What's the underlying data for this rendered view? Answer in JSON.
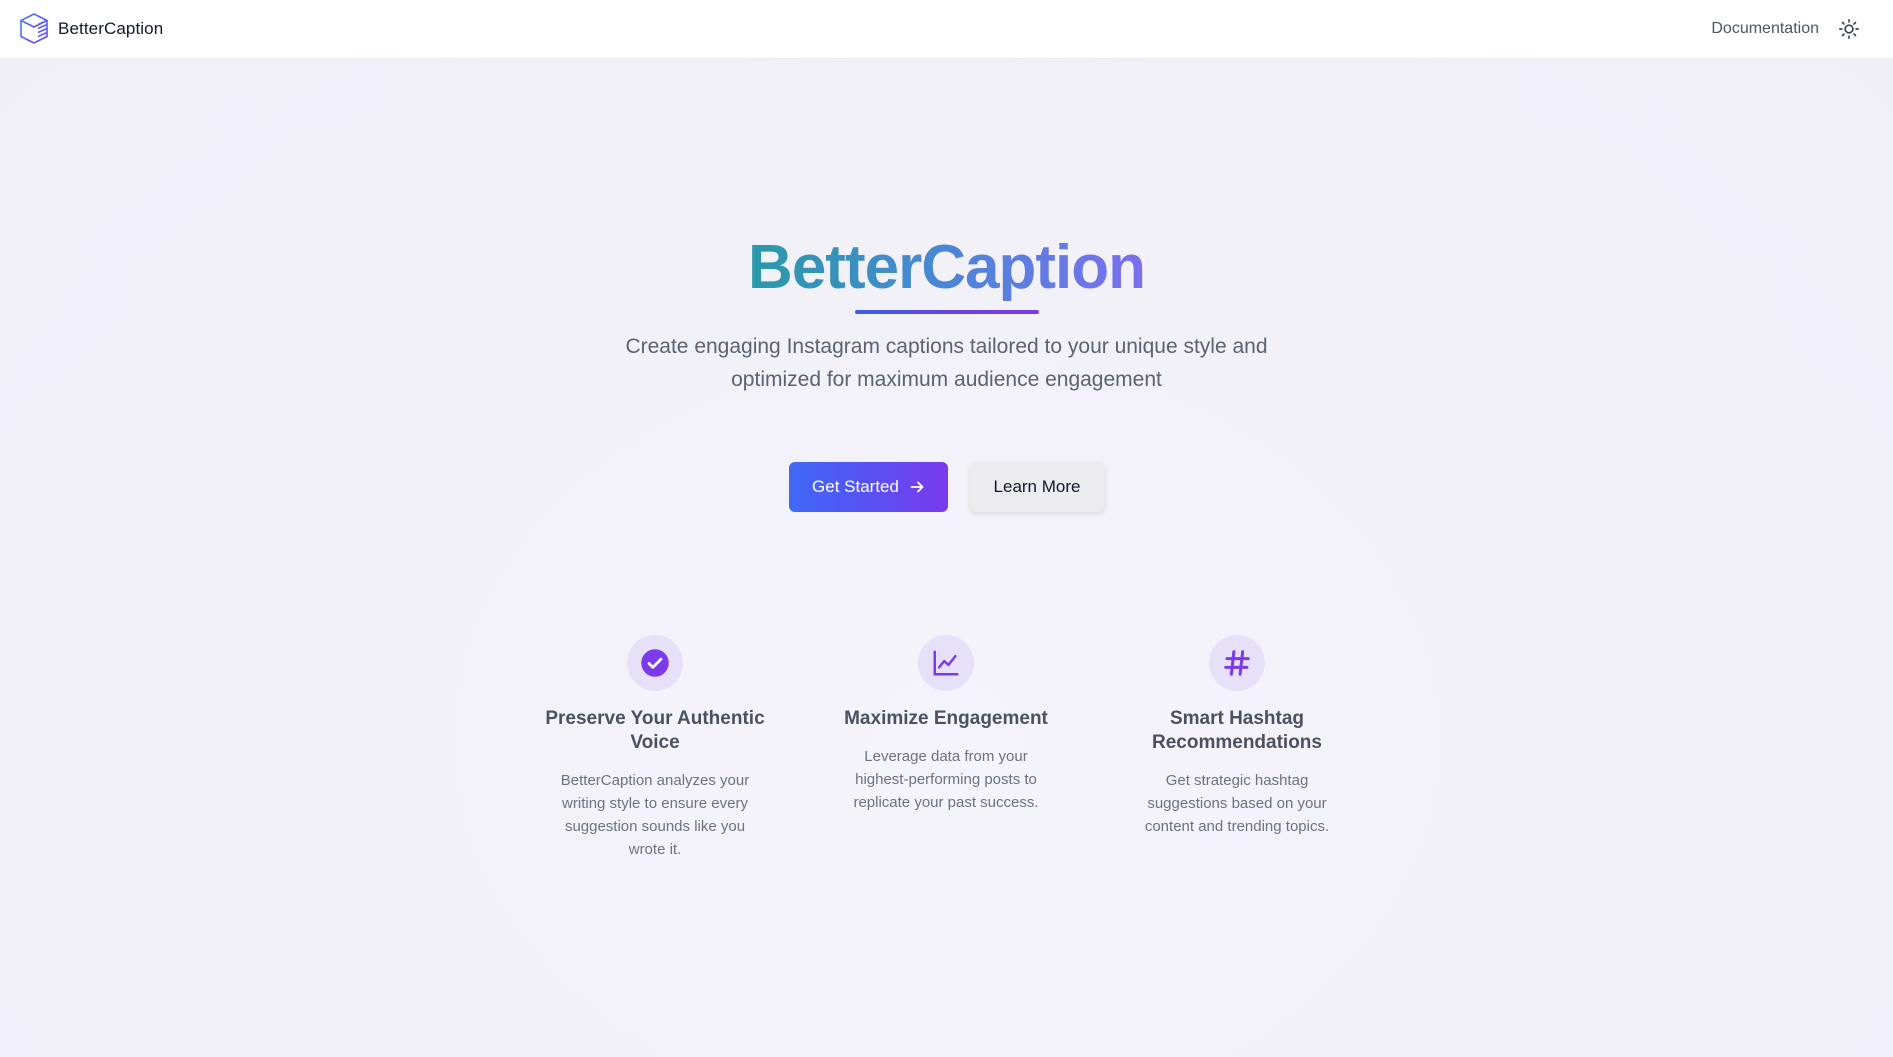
{
  "nav": {
    "brand": "BetterCaption",
    "documentation": "Documentation",
    "theme_icon": "sun-icon"
  },
  "hero": {
    "title": "BetterCaption",
    "subtitle": "Create engaging Instagram captions tailored to your unique style and optimized for maximum audience engagement",
    "primary_cta": "Get Started",
    "secondary_cta": "Learn More"
  },
  "features": [
    {
      "icon": "check-circle-icon",
      "title": "Preserve Your Authentic Voice",
      "description": "BetterCaption analyzes your writing style to ensure every suggestion sounds like you wrote it."
    },
    {
      "icon": "line-chart-icon",
      "title": "Maximize Engagement",
      "description": "Leverage data from your highest-performing posts to replicate your past success."
    },
    {
      "icon": "hashtag-icon",
      "title": "Smart Hashtag Recommendations",
      "description": "Get strategic hashtag suggestions based on your content and trending topics."
    }
  ],
  "colors": {
    "accent_blue": "#3f69f5",
    "accent_purple": "#7c3aed",
    "icon_bg": "#e6e1f8"
  }
}
